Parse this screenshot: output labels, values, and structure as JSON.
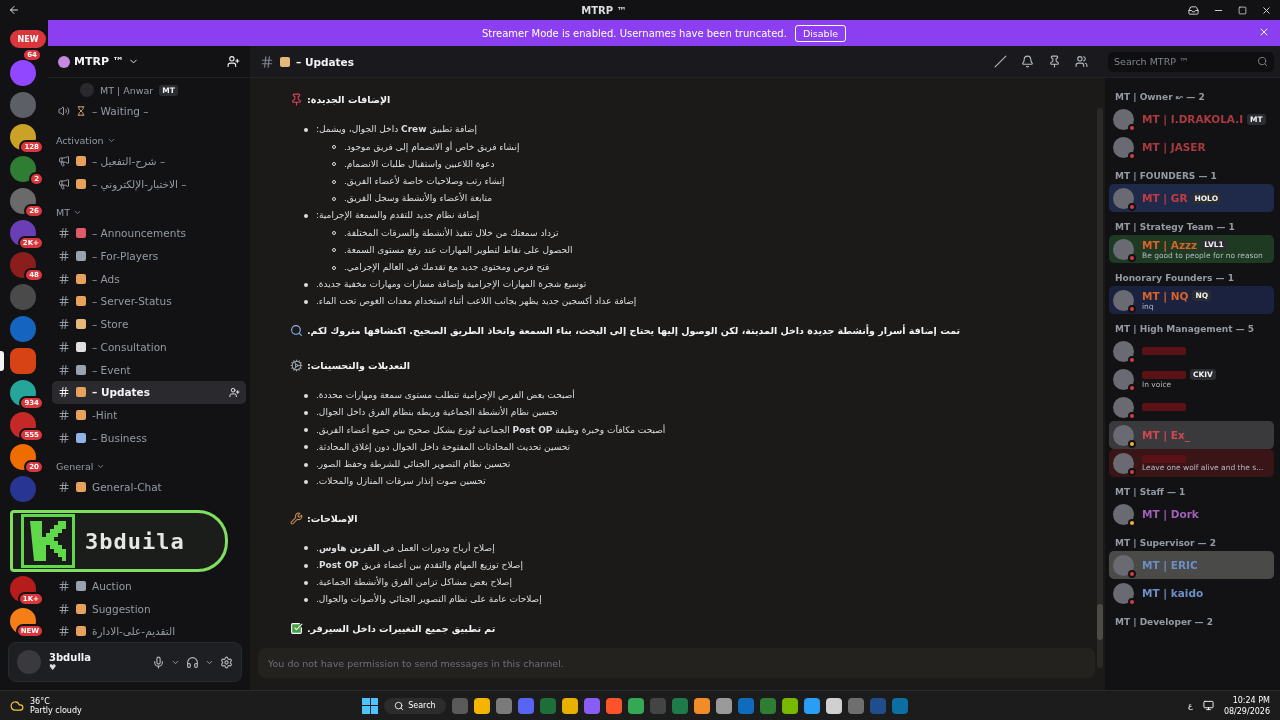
{
  "window": {
    "title": "MTRP ™"
  },
  "banner": {
    "text": "Streamer Mode is enabled. Usernames have been truncated.",
    "button": "Disable"
  },
  "servers_top": [
    {
      "kind": "pill",
      "label": "NEW",
      "badge": "64"
    },
    {
      "kind": "server",
      "color": "#9146ff",
      "selected": false
    },
    {
      "kind": "server",
      "color": "#5c5f66",
      "selected": false
    },
    {
      "kind": "server",
      "color": "#c9a227",
      "badge": "128",
      "selected": false
    },
    {
      "kind": "server",
      "color": "#2e7d32",
      "badge": "2",
      "selected": false
    },
    {
      "kind": "server",
      "color": "#6a6a6a",
      "badge": "26",
      "selected": false
    },
    {
      "kind": "server",
      "color": "#6a3fb5",
      "badge": "2K+",
      "selected": false
    },
    {
      "kind": "server",
      "color": "#8b1d1d",
      "badge": "48",
      "selected": false
    },
    {
      "kind": "server",
      "color": "#4a4a4a",
      "selected": false
    },
    {
      "kind": "server",
      "color": "#1565c0",
      "selected": false
    },
    {
      "kind": "server",
      "color": "#d84315",
      "selected": true
    },
    {
      "kind": "server",
      "color": "#26a69a",
      "badge": "934",
      "selected": false
    },
    {
      "kind": "server",
      "color": "#c62828",
      "badge": "555",
      "selected": false
    },
    {
      "kind": "server",
      "color": "#ef6c00",
      "badge": "20",
      "selected": false
    },
    {
      "kind": "server",
      "color": "#283593",
      "selected": false
    }
  ],
  "servers_bottom": [
    {
      "kind": "server",
      "color": "#b71c1c",
      "badge": "1K+",
      "selected": false
    },
    {
      "kind": "server",
      "color": "#f57f17",
      "badge": "NEW",
      "selected": false
    }
  ],
  "server": {
    "name": "MTRP ™"
  },
  "voice_user": {
    "name": "MT | Anwar",
    "tag": "MT"
  },
  "voice_channel": {
    "name": "–  Waiting  –"
  },
  "categories": [
    {
      "name": "Activation",
      "channels": [
        {
          "kind": "announce",
          "name": "– شرح-التفعيل –",
          "selected": false
        },
        {
          "kind": "announce",
          "name": "– الاختبار-الإلكتروني –",
          "selected": false
        }
      ]
    },
    {
      "name": "MT",
      "channels": [
        {
          "kind": "text",
          "name": "– Announcements",
          "selected": false
        },
        {
          "kind": "text",
          "name": "– For-Players",
          "selected": false
        },
        {
          "kind": "text",
          "name": "– Ads",
          "selected": false
        },
        {
          "kind": "text",
          "name": "– Server-Status",
          "selected": false
        },
        {
          "kind": "text",
          "name": "– Store",
          "selected": false
        },
        {
          "kind": "text",
          "name": "– Consultation",
          "selected": false
        },
        {
          "kind": "text",
          "name": "– Event",
          "selected": false
        },
        {
          "kind": "text",
          "name": "– Updates",
          "selected": true
        },
        {
          "kind": "text",
          "name": "-Hint",
          "selected": false
        },
        {
          "kind": "text",
          "name": "– Business",
          "selected": false
        }
      ]
    },
    {
      "name": "General",
      "channels": [
        {
          "kind": "text",
          "name": "General-Chat",
          "selected": false
        }
      ]
    },
    {
      "channels": [
        {
          "kind": "text",
          "name": "Auction",
          "selected": false
        },
        {
          "kind": "text",
          "name": "Suggestion",
          "selected": false
        },
        {
          "kind": "text",
          "name": "التقديم-على-الادارة",
          "selected": false
        }
      ]
    }
  ],
  "stream_overlay": {
    "text": "3bduila"
  },
  "user_panel": {
    "name": "3bdulla",
    "status": "♥"
  },
  "chat_header": {
    "channel": "– Updates",
    "search_placeholder": "Search MTRP ™"
  },
  "message": [
    {
      "kind": "heading",
      "text": "الإضافات الجديدة:"
    },
    {
      "kind": "bullets",
      "items": [
        {
          "text": "إضافة تطبيق **Crew** داخل الجوال، ويشمل:",
          "children": [
            {
              "text": "إنشاء فريق خاص أو الانضمام إلى فريق موجود."
            },
            {
              "text": "دعوة اللاعبين واستقبال طلبات الانضمام."
            },
            {
              "text": "إنشاء رتب وصلاحيات خاصة لأعضاء الفريق."
            },
            {
              "text": "متابعة الأعضاء والأنشطة وسجل الفريق."
            }
          ]
        },
        {
          "text": "إضافة نظام جديد للتقدم والسمعة الإجرامية:",
          "children": [
            {
              "text": "تزداد سمعتك من خلال تنفيذ الأنشطة والسرقات المختلفة."
            },
            {
              "text": "الحصول على نقاط لتطوير المهارات عند رفع مستوى السمعة."
            },
            {
              "text": "فتح فرص ومحتوى جديد مع تقدمك في العالم الإجرامي."
            }
          ]
        },
        {
          "text": "توسيع شجرة المهارات الإجرامية وإضافة مسارات ومهارات مخفية جديدة."
        },
        {
          "text": "إضافة عداد أكسجين جديد يظهر بجانب اللاعب أثناء استخدام معدات الغوص تحت الماء."
        }
      ]
    },
    {
      "kind": "callout",
      "text": "تمت إضافة أسرار وأنشطة جديدة داخل المدينة، لكن الوصول إليها يحتاج إلى البحث، بناء السمعة واتخاذ الطريق الصحيح. اكتشافها متروك لكم."
    },
    {
      "kind": "heading",
      "text": "التعديلات والتحسينات:"
    },
    {
      "kind": "bullets",
      "items": [
        {
          "text": "أصبحت بعض الفرص الإجرامية تتطلب مستوى سمعة ومهارات محددة."
        },
        {
          "text": "تحسين نظام الأنشطة الجماعية وربطه بنظام الفرق داخل الجوال."
        },
        {
          "text": "أصبحت مكافآت وخبرة وظيفة **Post OP** الجماعية تُوزع بشكل صحيح بين جميع أعضاء الفريق."
        },
        {
          "text": "تحسين تحديث المحادثات المفتوحة داخل الجوال دون إغلاق المحادثة."
        },
        {
          "text": "تحسين نظام التصوير الجنائي للشرطة وحفظ الصور."
        },
        {
          "text": "تحسين صوت إنذار سرقات المنازل والمحلات."
        }
      ]
    },
    {
      "kind": "heading",
      "text": "الإصلاحات:"
    },
    {
      "kind": "bullets",
      "items": [
        {
          "text": "إصلاح أرباح ودورات العمل في **القرين هاوس**."
        },
        {
          "text": "إصلاح توزيع المهام والتقدم بين أعضاء فريق **Post OP**."
        },
        {
          "text": "إصلاح بعض مشاكل تزامن الفرق والأنشطة الجماعية."
        },
        {
          "text": "إصلاحات عامة على نظام التصوير الجنائي والأصوات والجوال."
        }
      ]
    },
    {
      "kind": "callout",
      "text": "تم تطبيق جميع التغييرات داخل السيرفر."
    }
  ],
  "composer": {
    "notice": "You do not have permission to send messages in this channel."
  },
  "member_groups": [
    {
      "title": "MT | Owner ↜ — 2",
      "members": [
        {
          "name": "MT | I.DRAKOLA.I",
          "color": "#a83a40",
          "tag": "MT",
          "idle": false,
          "highlighted": false
        },
        {
          "name": "MT | JASER",
          "color": "#a83a40",
          "idle": false,
          "highlighted": false
        }
      ]
    },
    {
      "title": "MT | FOUNDERS — 1",
      "members": [
        {
          "name": "MT | GR",
          "color": "#c83a40",
          "tag": "HOLO",
          "idle": false,
          "highlighted": true
        }
      ]
    },
    {
      "title": "MT | Strategy Team — 1",
      "members": [
        {
          "name": "MT | Azzz",
          "color": "#d9622b",
          "tag": "LVL1",
          "status": "Be good to people for no reason",
          "idle": false,
          "highlighted": true
        }
      ]
    },
    {
      "title": "Honorary Founders — 1",
      "members": [
        {
          "name": "MT | NQ",
          "color": "#d9622b",
          "tag": "NQ",
          "status": "inq",
          "idle": false,
          "highlighted": true
        }
      ]
    },
    {
      "title": "MT | High Management — 5",
      "members": [
        {
          "color": "#5a1216",
          "idle": false,
          "highlighted": false
        },
        {
          "color": "#5a1216",
          "tag": "CKIV",
          "status": "In voice",
          "idle": false,
          "highlighted": false
        },
        {
          "color": "#5a1216",
          "idle": false,
          "highlighted": false
        },
        {
          "name": "MT | Ex_",
          "color": "#d04850",
          "idle": true,
          "highlighted": true
        },
        {
          "color": "#5a1216",
          "status": "Leave one wolf alive and the s...",
          "idle": false,
          "highlighted": true
        }
      ]
    },
    {
      "title": "MT | Staff — 1",
      "members": [
        {
          "name": "MT | Dork",
          "color": "#a05fb8",
          "idle": true,
          "highlighted": false
        }
      ]
    },
    {
      "title": "MT | Supervisor — 2",
      "members": [
        {
          "name": "MT | ERIC",
          "color": "#6b8fc4",
          "idle": false,
          "highlighted": true
        },
        {
          "name": "MT | kaido",
          "color": "#6b8fc4",
          "idle": false,
          "highlighted": false
        }
      ]
    },
    {
      "title": "MT | Developer — 2"
    }
  ],
  "taskbar": {
    "temperature": "36°C",
    "weather": "Partly cloudy",
    "search": "Search",
    "apps": [
      {
        "color": "#5a5a5a"
      },
      {
        "color": "#f4b400"
      },
      {
        "color": "#7a7a7a"
      },
      {
        "color": "#5865f2"
      },
      {
        "color": "#1e6e3a"
      },
      {
        "color": "#e8b100"
      },
      {
        "color": "#8a5cf6"
      },
      {
        "color": "#fb542b"
      },
      {
        "color": "#34a853"
      },
      {
        "color": "#444444"
      },
      {
        "color": "#1e7a48"
      },
      {
        "color": "#f28c28"
      },
      {
        "color": "#9a9a9a"
      },
      {
        "color": "#0f6cbd"
      },
      {
        "color": "#2e7d32"
      },
      {
        "color": "#76b900"
      },
      {
        "color": "#2a9df4"
      },
      {
        "color": "#d0d0d0"
      },
      {
        "color": "#6e6e6e"
      },
      {
        "color": "#1f4e8c"
      },
      {
        "color": "#0b6fa4"
      }
    ],
    "language": "ع",
    "time": "10:24 PM",
    "date": "08/29/2026"
  }
}
